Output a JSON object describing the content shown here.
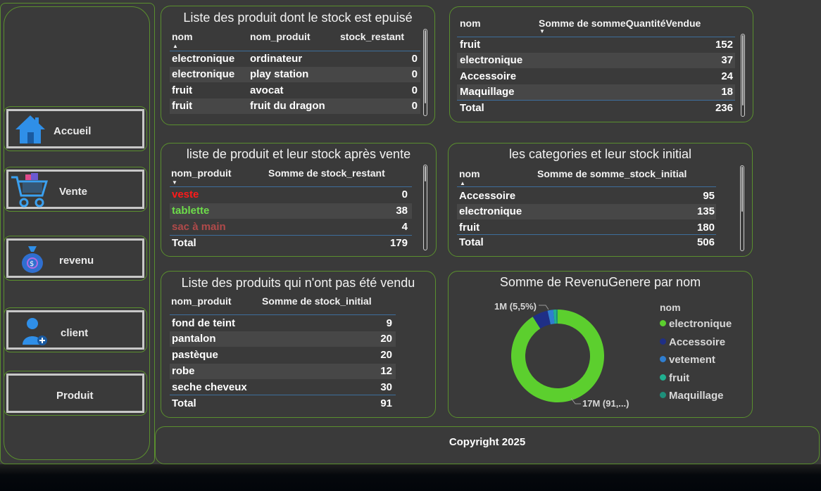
{
  "sidebar": {
    "items": [
      {
        "label": "Accueil",
        "icon": "home-icon"
      },
      {
        "label": "Vente",
        "icon": "shopping-cart-icon"
      },
      {
        "label": "revenu",
        "icon": "money-bag-icon"
      },
      {
        "label": "client",
        "icon": "user-add-icon"
      },
      {
        "label": "Produit",
        "icon": ""
      }
    ]
  },
  "out_of_stock": {
    "title": "Liste des produit dont le stock est epuisé",
    "headers": [
      "nom",
      "nom_produit",
      "stock_restant"
    ],
    "rows": [
      [
        "electronique",
        "ordinateur",
        "0"
      ],
      [
        "electronique",
        "play station",
        "0"
      ],
      [
        "fruit",
        "avocat",
        "0"
      ],
      [
        "fruit",
        "fruit du dragon",
        "0"
      ]
    ]
  },
  "qty_sold": {
    "headers": [
      "nom",
      "Somme de sommeQuantitéVendue"
    ],
    "rows": [
      [
        "fruit",
        "152"
      ],
      [
        "electronique",
        "37"
      ],
      [
        "Accessoire",
        "24"
      ],
      [
        "Maquillage",
        "18"
      ]
    ],
    "total": [
      "Total",
      "236"
    ]
  },
  "stock_after_sale": {
    "title": "liste de produit et leur stock après vente",
    "headers": [
      "nom_produit",
      "Somme de stock_restant"
    ],
    "rows": [
      {
        "name": "veste",
        "value": "0",
        "color": "#ff1a1a"
      },
      {
        "name": "tablette",
        "value": "38",
        "color": "#6ddc4a"
      },
      {
        "name": "sac à main",
        "value": "4",
        "color": "#b04a4a"
      }
    ],
    "total": [
      "Total",
      "179"
    ]
  },
  "initial_stock": {
    "title": "les categories et leur stock initial",
    "headers": [
      "nom",
      "Somme de somme_stock_initial"
    ],
    "rows": [
      [
        "Accessoire",
        "95"
      ],
      [
        "electronique",
        "135"
      ],
      [
        "fruit",
        "180"
      ]
    ],
    "total": [
      "Total",
      "506"
    ]
  },
  "not_sold": {
    "title": "Liste des produits qui n'ont pas été vendu",
    "headers": [
      "nom_produit",
      "Somme de stock_initial"
    ],
    "rows": [
      [
        "fond de teint",
        "9"
      ],
      [
        "pantalon",
        "20"
      ],
      [
        "pastèque",
        "20"
      ],
      [
        "robe",
        "12"
      ],
      [
        "seche cheveux",
        "30"
      ]
    ],
    "total": [
      "Total",
      "91"
    ]
  },
  "revenue_chart": {
    "title": "Somme de RevenuGenere par nom",
    "legend_title": "nom",
    "label_small": "1M (5,5%)",
    "label_large": "17M (91,...)"
  },
  "chart_data": {
    "type": "pie",
    "title": "Somme de RevenuGenere par nom",
    "legend_title": "nom",
    "categories": [
      "electronique",
      "Accessoire",
      "vetement",
      "fruit",
      "Maquillage"
    ],
    "values": [
      91.0,
      5.5,
      2.0,
      1.0,
      0.5
    ],
    "unit": "percent of total",
    "colors": [
      "#5ccf2e",
      "#1f2f86",
      "#2f7ed0",
      "#20b090",
      "#1e8f7a"
    ],
    "data_labels": [
      "17M (91,...)",
      "1M (5,5%)"
    ],
    "donut": true,
    "legend_position": "right"
  },
  "footer": {
    "copyright": "Copyright 2025"
  }
}
